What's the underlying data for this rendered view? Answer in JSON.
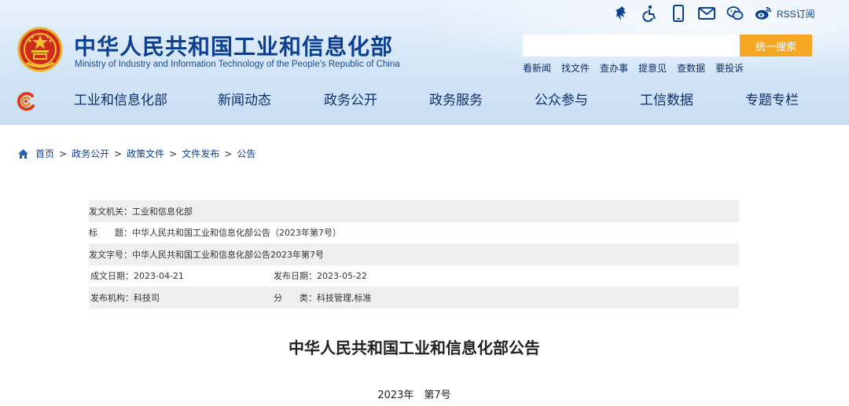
{
  "header": {
    "title": "中华人民共和国工业和信息化部",
    "subtitle": "Ministry of Industry and Information Technology of the People's Republic of China",
    "top_icons": [
      "mobile-app-icon",
      "accessibility-icon",
      "phone-icon",
      "mail-icon",
      "wechat-icon",
      "weibo-icon"
    ],
    "rss_label": "RSS订阅",
    "search": {
      "placeholder": "",
      "button_label": "统一搜索"
    },
    "quick_links": [
      "看新闻",
      "找文件",
      "查办事",
      "提意见",
      "查数据",
      "要投诉"
    ],
    "colors": {
      "brand": "#0c3f8f",
      "search_button": "#f5a623"
    }
  },
  "nav": {
    "items": [
      "工业和信息化部",
      "新闻动态",
      "政务公开",
      "政务服务",
      "公众参与",
      "工信数据",
      "专题专栏"
    ]
  },
  "breadcrumb": [
    "首页",
    "政务公开",
    "政策文件",
    "文件发布",
    "公告"
  ],
  "breadcrumb_sep": ">",
  "info": {
    "issuer_label": "发文机关：",
    "issuer": "工业和信息化部",
    "title_label": "标　　题：",
    "title": "中华人民共和国工业和信息化部公告（2023年第7号）",
    "doc_no_label": "发文字号：",
    "doc_no": "中华人民共和国工业和信息化部公告2023年第7号",
    "created_label": "成文日期：",
    "created": "2023-04-21",
    "published_label": "发布日期：",
    "published": "2023-05-22",
    "org_label": "发布机构：",
    "org": "科技司",
    "category_label": "分　　类：",
    "category": "科技管理,标准"
  },
  "article": {
    "title": "中华人民共和国工业和信息化部公告",
    "number": "2023年　第7号"
  }
}
